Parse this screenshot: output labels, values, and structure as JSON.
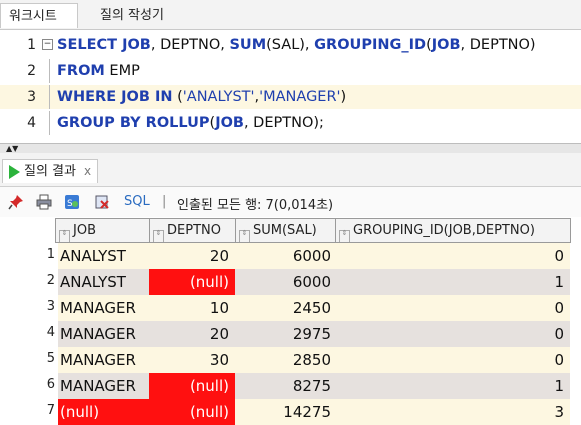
{
  "tabs": {
    "worksheet": "워크시트",
    "query_builder": "질의 작성기"
  },
  "editor": {
    "lines": [
      {
        "num": "1",
        "parts": [
          [
            "kw",
            "SELECT JOB"
          ],
          [
            "t",
            ", DEPTNO, "
          ],
          [
            "kw",
            "SUM"
          ],
          [
            "t",
            "(SAL), "
          ],
          [
            "kw",
            "GROUPING_ID"
          ],
          [
            "t",
            "("
          ],
          [
            "kw",
            "JOB"
          ],
          [
            "t",
            ", DEPTNO)"
          ]
        ]
      },
      {
        "num": "2",
        "parts": [
          [
            "kw",
            "FROM"
          ],
          [
            "t",
            " EMP"
          ]
        ]
      },
      {
        "num": "3",
        "parts": [
          [
            "kw",
            "WHERE JOB IN"
          ],
          [
            "t",
            " ("
          ],
          [
            "str",
            "'ANALYST'"
          ],
          [
            "t",
            ","
          ],
          [
            "str",
            "'MANAGER'"
          ],
          [
            "t",
            ")"
          ]
        ]
      },
      {
        "num": "4",
        "parts": [
          [
            "kw",
            "GROUP BY ROLLUP"
          ],
          [
            "t",
            "("
          ],
          [
            "kw",
            "JOB"
          ],
          [
            "t",
            ", DEPTNO);"
          ]
        ]
      }
    ]
  },
  "results": {
    "tab_label": "질의 결과",
    "close_label": "x",
    "sql_label": "SQL",
    "separator": "|",
    "status": "인출된 모든 행: 7(0,014초)",
    "columns": [
      "JOB",
      "DEPTNO",
      "SUM(SAL)",
      "GROUPING_ID(JOB,DEPTNO)"
    ],
    "rows": [
      {
        "n": "1",
        "job": "ANALYST",
        "dept": "20",
        "sal": "6000",
        "grp": "0"
      },
      {
        "n": "2",
        "job": "ANALYST",
        "dept": "(null)",
        "sal": "6000",
        "grp": "1"
      },
      {
        "n": "3",
        "job": "MANAGER",
        "dept": "10",
        "sal": "2450",
        "grp": "0"
      },
      {
        "n": "4",
        "job": "MANAGER",
        "dept": "20",
        "sal": "2975",
        "grp": "0"
      },
      {
        "n": "5",
        "job": "MANAGER",
        "dept": "30",
        "sal": "2850",
        "grp": "0"
      },
      {
        "n": "6",
        "job": "MANAGER",
        "dept": "(null)",
        "sal": "8275",
        "grp": "1"
      },
      {
        "n": "7",
        "job": "(null)",
        "dept": "(null)",
        "sal": "14275",
        "grp": "3"
      }
    ],
    "null_color": "#ff1010"
  }
}
